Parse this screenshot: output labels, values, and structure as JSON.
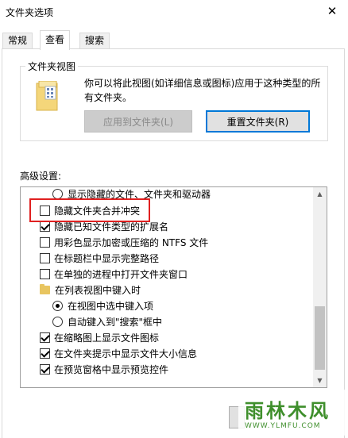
{
  "window": {
    "title": "文件夹选项",
    "close_label": "✕"
  },
  "tabs": [
    {
      "label": "常规",
      "active": false
    },
    {
      "label": "查看",
      "active": true
    },
    {
      "label": "搜索",
      "active": false
    }
  ],
  "folder_views": {
    "label": "文件夹视图",
    "description": "你可以将此视图(如详细信息或图标)应用于这种类型的所有文件夹。",
    "apply_button": "应用到文件夹(L)",
    "reset_button": "重置文件夹(R)"
  },
  "advanced": {
    "label": "高级设置:",
    "items": [
      {
        "type": "radio",
        "label": "显示隐藏的文件、文件夹和驱动器",
        "checked": false
      },
      {
        "type": "checkbox",
        "label": "隐藏文件夹合并冲突",
        "checked": false
      },
      {
        "type": "checkbox",
        "label": "隐藏已知文件类型的扩展名",
        "checked": true
      },
      {
        "type": "checkbox",
        "label": "用彩色显示加密或压缩的 NTFS 文件",
        "checked": false
      },
      {
        "type": "checkbox",
        "label": "在标题栏中显示完整路径",
        "checked": false
      },
      {
        "type": "checkbox",
        "label": "在单独的进程中打开文件夹窗口",
        "checked": false
      },
      {
        "type": "folder",
        "label": "在列表视图中键入时"
      },
      {
        "type": "radio",
        "label": "在视图中选中键入项",
        "checked": true
      },
      {
        "type": "radio",
        "label": "自动键入到\"搜索\"框中",
        "checked": false
      },
      {
        "type": "checkbox",
        "label": "在缩略图上显示文件图标",
        "checked": true
      },
      {
        "type": "checkbox",
        "label": "在文件夹提示中显示文件大小信息",
        "checked": true
      },
      {
        "type": "checkbox",
        "label": "在预览窗格中显示预览控件",
        "checked": true
      }
    ]
  },
  "watermark": {
    "text": "雨林木风",
    "url": "WWW.YLMFU.COM"
  }
}
